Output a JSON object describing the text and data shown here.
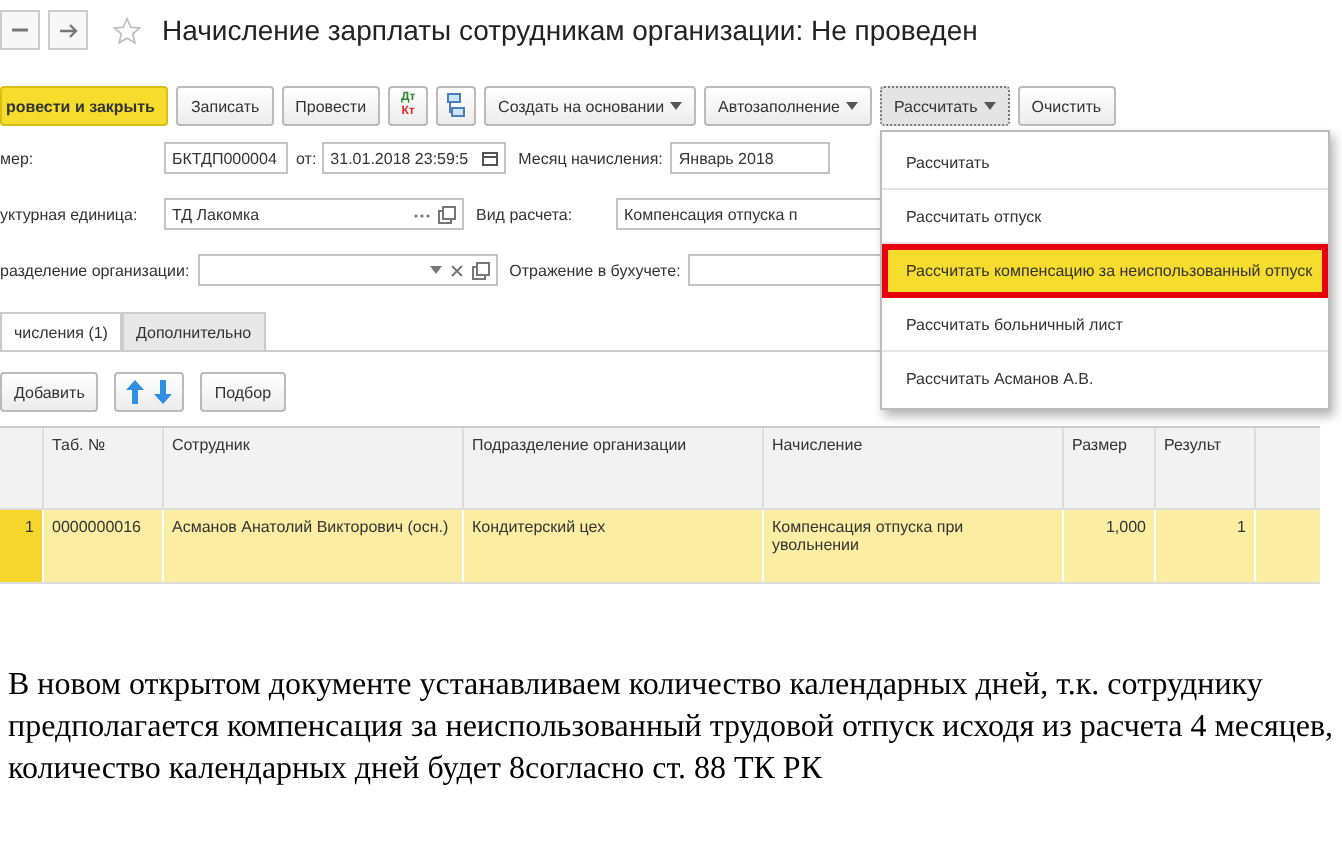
{
  "header": {
    "title": "Начисление зарплаты сотрудникам организации: Не проведен"
  },
  "toolbar": [
    {
      "kind": "primary",
      "label": "ровести и закрыть"
    },
    {
      "kind": "button",
      "label": "Записать"
    },
    {
      "kind": "button",
      "label": "Провести"
    },
    {
      "kind": "dtkt",
      "labels": [
        "Дт",
        "Кт"
      ]
    },
    {
      "kind": "structure"
    },
    {
      "kind": "dropdown",
      "label": "Создать на основании",
      "expanded": false
    },
    {
      "kind": "dropdown",
      "label": "Автозаполнение",
      "expanded": false
    },
    {
      "kind": "dropdown",
      "label": "Рассчитать",
      "expanded": true
    },
    {
      "kind": "button",
      "label": "Очистить"
    }
  ],
  "menu": [
    {
      "label": "Рассчитать",
      "selected": false,
      "highlighted": false
    },
    {
      "label": "Рассчитать отпуск",
      "selected": false,
      "highlighted": false
    },
    {
      "label": "Рассчитать компенсацию за неиспользованный отпуск",
      "selected": true,
      "highlighted": true
    },
    {
      "label": "Рассчитать больничный лист",
      "selected": false,
      "highlighted": false
    },
    {
      "label": "Рассчитать Асманов А.В.",
      "selected": false,
      "highlighted": false
    }
  ],
  "form": {
    "number_label": "мер:",
    "number": "БКТДП000004",
    "date_label": "от:",
    "date": "31.01.2018 23:59:5",
    "month_label": "Месяц начисления:",
    "month": "Январь 2018",
    "unit_label": "уктурная единица:",
    "unit": "ТД Лакомка",
    "calc_label": "Вид расчета:",
    "calc": "Компенсация отпуска п",
    "dept_label": "разделение организации:",
    "posting_label": "Отражение в бухучете:"
  },
  "tabs": [
    {
      "label": "числения (1)",
      "selected": true
    },
    {
      "label": "Дополнительно",
      "selected": false
    }
  ],
  "table_toolbar": {
    "add": "Добавить",
    "pick": "Подбор"
  },
  "table": {
    "columns": [
      "Таб. №",
      "Сотрудник",
      "Подразделение организации",
      "Начисление",
      "Размер",
      "Результ"
    ],
    "rows": [
      {
        "number": "1",
        "selected": true,
        "cells": [
          "0000000016",
          "Асманов Анатолий Викторович (осн.)",
          "Кондитерский цех",
          "Компенсация отпуска при увольнении",
          "1,000",
          "1"
        ]
      }
    ]
  },
  "paragraph": "В новом открытом документе устанавливаем количество календарных дней, т.к. сотруднику предполагается компенсация за неиспользованный трудовой отпуск исходя из расчета 4 месяцев, количество календарных дней будет 8согласно ст. 88 ТК РК"
}
